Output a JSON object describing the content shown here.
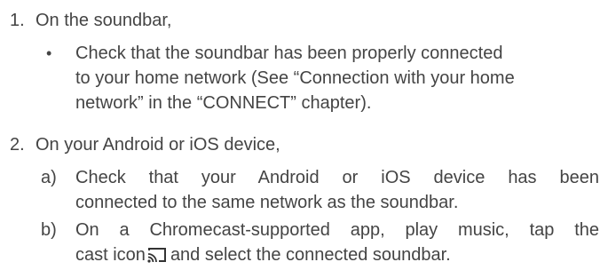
{
  "steps": [
    {
      "number": "1.",
      "text": "On the soundbar,",
      "bullets": [
        {
          "symbol": "•",
          "lines": [
            "Check that the soundbar has been properly connected",
            "to your home network (See “Connection with your home",
            "network” in the “CONNECT” chapter)."
          ]
        }
      ]
    },
    {
      "number": "2.",
      "text": "On your Android or iOS device,",
      "subitems": [
        {
          "marker": "a)",
          "lines": [
            "Check that your Android or iOS device has been",
            "connected to the same network as the soundbar."
          ]
        },
        {
          "marker": "b)",
          "line1": "On a Chromecast-supported app, play music, tap the",
          "line2_before_icon": "cast icon",
          "line2_after_icon": "and select the connected soundbar.",
          "icon": "cast-icon"
        }
      ]
    }
  ]
}
